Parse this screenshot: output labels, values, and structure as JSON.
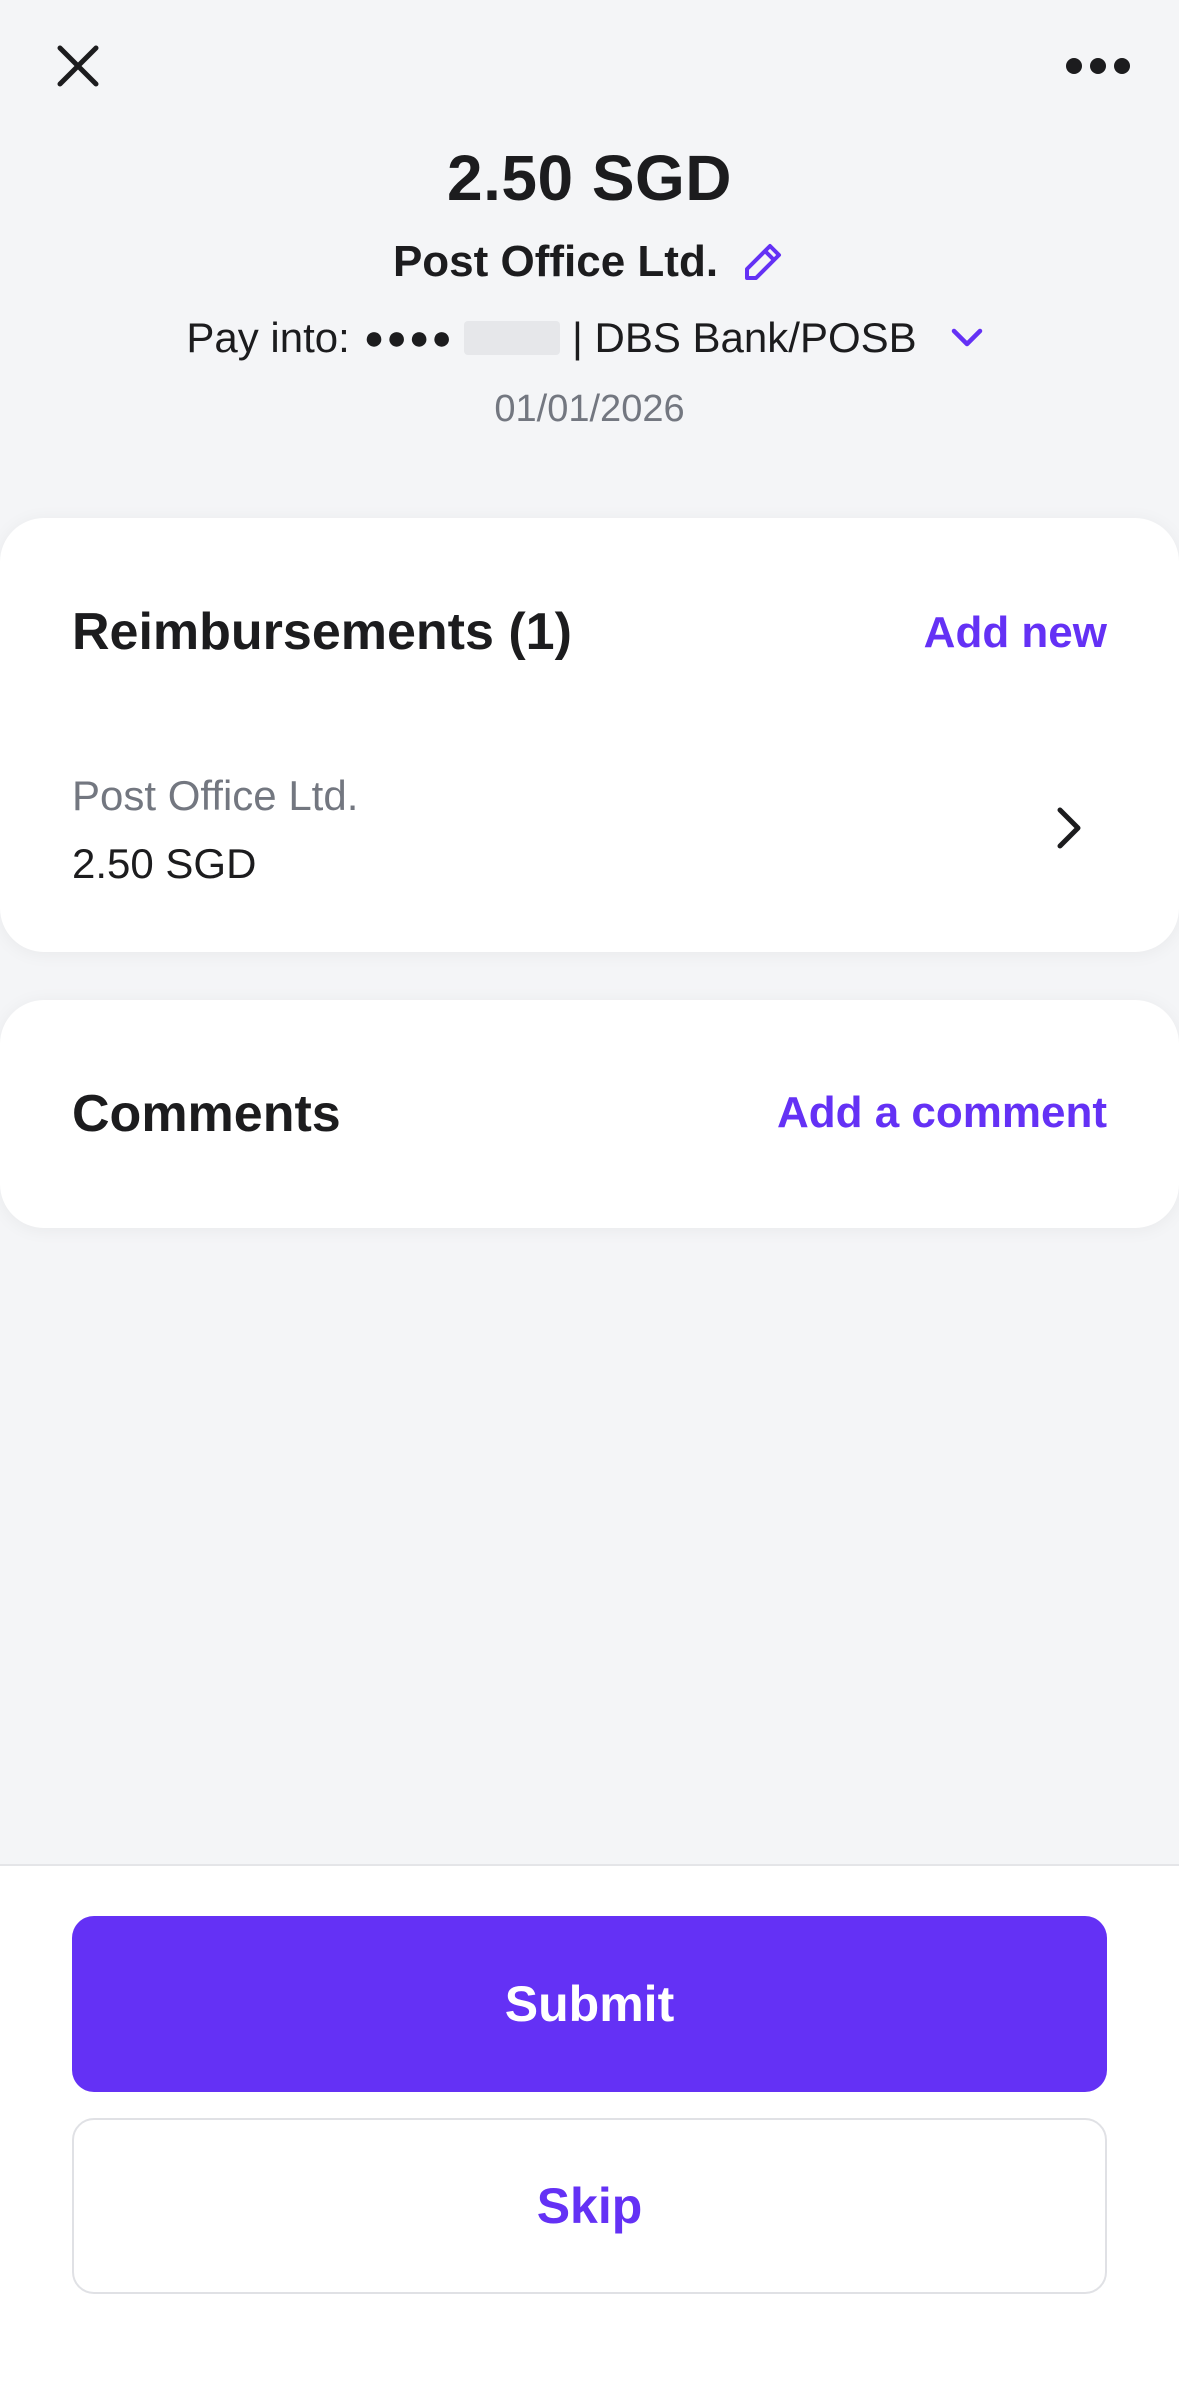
{
  "top_bar": {
    "close_icon": "close-icon",
    "more_icon": "more-horizontal-icon"
  },
  "header": {
    "amount": "2.50 SGD",
    "merchant": "Post Office Ltd.",
    "pay_into_label": "Pay into:",
    "account_dots": "●●●●",
    "bank_name": "| DBS Bank/POSB",
    "date": "01/01/2026"
  },
  "reimbursements": {
    "title": "Reimbursements (1)",
    "add_label": "Add new",
    "items": [
      {
        "merchant": "Post Office Ltd.",
        "amount": "2.50 SGD"
      }
    ]
  },
  "comments": {
    "title": "Comments",
    "add_label": "Add a comment"
  },
  "actions": {
    "submit_label": "Submit",
    "skip_label": "Skip"
  },
  "colors": {
    "accent": "#6431f5",
    "background": "#f4f5f7",
    "card": "#ffffff",
    "text_primary": "#1c1c1e",
    "text_secondary": "#737780"
  }
}
